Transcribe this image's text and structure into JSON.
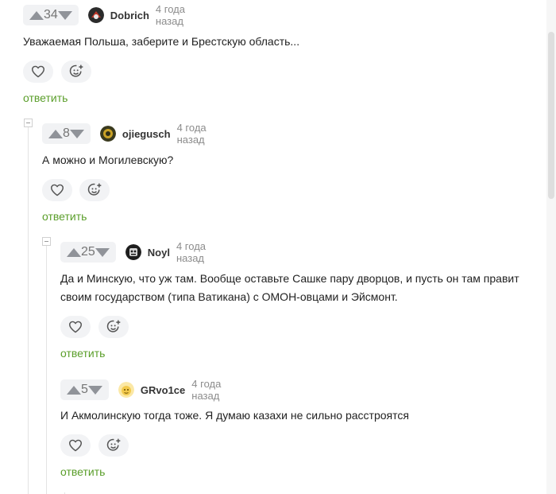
{
  "icons": {
    "upvote": "triangle-up-icon",
    "downvote": "triangle-down-icon",
    "like": "heart-icon",
    "react": "smiley-plus-icon",
    "collapse": "minus-square-icon"
  },
  "colors": {
    "reply_link": "#5a9e2a",
    "vote_bg": "#f1f2f4",
    "arrow": "#909399"
  },
  "comments": [
    {
      "score": "34",
      "author": "Dobrich",
      "time": "4 года назад",
      "text_lines": [
        "Уважаемая Польша, заберите и Брестскую область..."
      ],
      "reply": "ответить"
    },
    {
      "score": "8",
      "author": "ojiegusch",
      "time": "4 года назад",
      "text_lines": [
        "А можно и Могилевскую?"
      ],
      "reply": "ответить"
    },
    {
      "score": "25",
      "author": "Noyl",
      "time": "4 года назад",
      "text_lines": [
        "Да и Минскую, что уж там. Вообще оставьте Сашке пару дворцов, и пусть он там правит",
        "своим государством (типа Ватикана) с ОМОН-овцами и Эйсмонт."
      ],
      "reply": "ответить"
    },
    {
      "score": "5",
      "author": "GRvo1ce",
      "time": "4 года назад",
      "text_lines": [
        "И Акмолинскую тогда тоже. Я думаю казахи не сильно расстроятся"
      ],
      "reply": "ответить"
    }
  ]
}
